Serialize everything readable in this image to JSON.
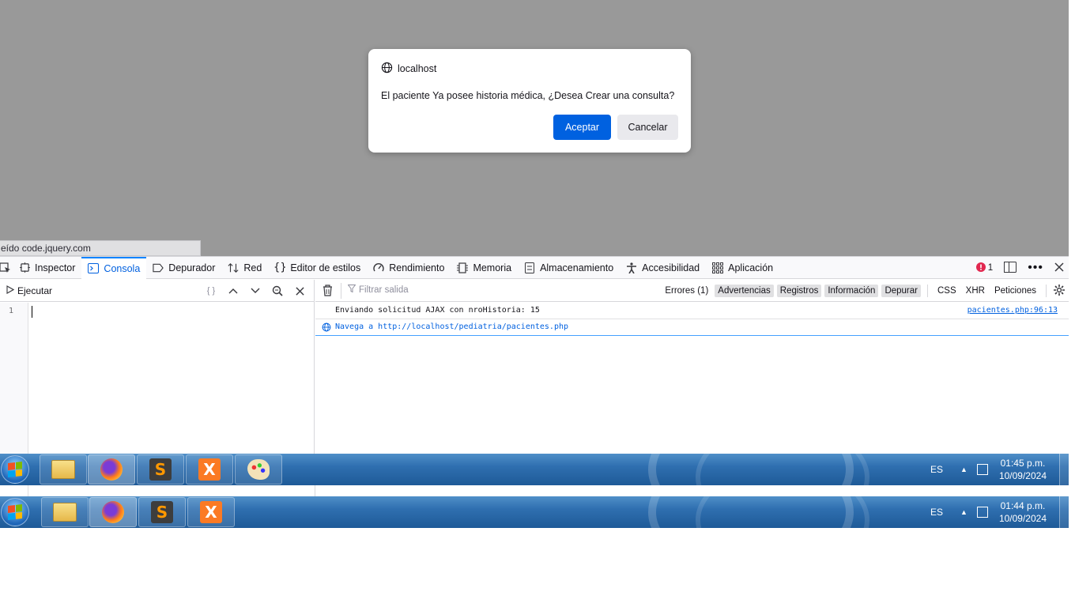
{
  "status_link": "eído code.jquery.com",
  "dialog": {
    "origin": "localhost",
    "message": "El paciente Ya posee historia médica, ¿Desea Crear una consulta?",
    "accept_label": "Aceptar",
    "cancel_label": "Cancelar"
  },
  "devtools": {
    "tabs": [
      {
        "label": "Inspector",
        "icon": "inspector-icon"
      },
      {
        "label": "Consola",
        "icon": "console-icon",
        "active": true
      },
      {
        "label": "Depurador",
        "icon": "debugger-icon"
      },
      {
        "label": "Red",
        "icon": "network-icon"
      },
      {
        "label": "Editor de estilos",
        "icon": "style-editor-icon"
      },
      {
        "label": "Rendimiento",
        "icon": "performance-icon"
      },
      {
        "label": "Memoria",
        "icon": "memory-icon"
      },
      {
        "label": "Almacenamiento",
        "icon": "storage-icon"
      },
      {
        "label": "Accesibilidad",
        "icon": "accessibility-icon"
      },
      {
        "label": "Aplicación",
        "icon": "application-icon"
      }
    ],
    "error_count": "1",
    "editor": {
      "run_label": "Ejecutar",
      "pretty_print": "{ }",
      "line_number": "1"
    },
    "output": {
      "filter_placeholder": "Filtrar salida",
      "filters": [
        "Errores (1)",
        "Advertencias",
        "Registros",
        "Información",
        "Depurar",
        "CSS",
        "XHR",
        "Peticiones"
      ],
      "messages": [
        {
          "text": "Enviando solicitud AJAX con nroHistoria: 15",
          "location": "pacientes.php:96:13"
        },
        {
          "text": "Navega a http://localhost/pediatria/pacientes.php"
        }
      ]
    }
  },
  "taskbar_top": {
    "lang": "ES",
    "time": "01:45 p.m.",
    "date": "10/09/2024"
  },
  "taskbar_bottom": {
    "lang": "ES",
    "time": "01:44 p.m.",
    "date": "10/09/2024"
  },
  "colors": {
    "accent": "#0061e0",
    "overlay": "#999999",
    "error": "#e22850"
  }
}
